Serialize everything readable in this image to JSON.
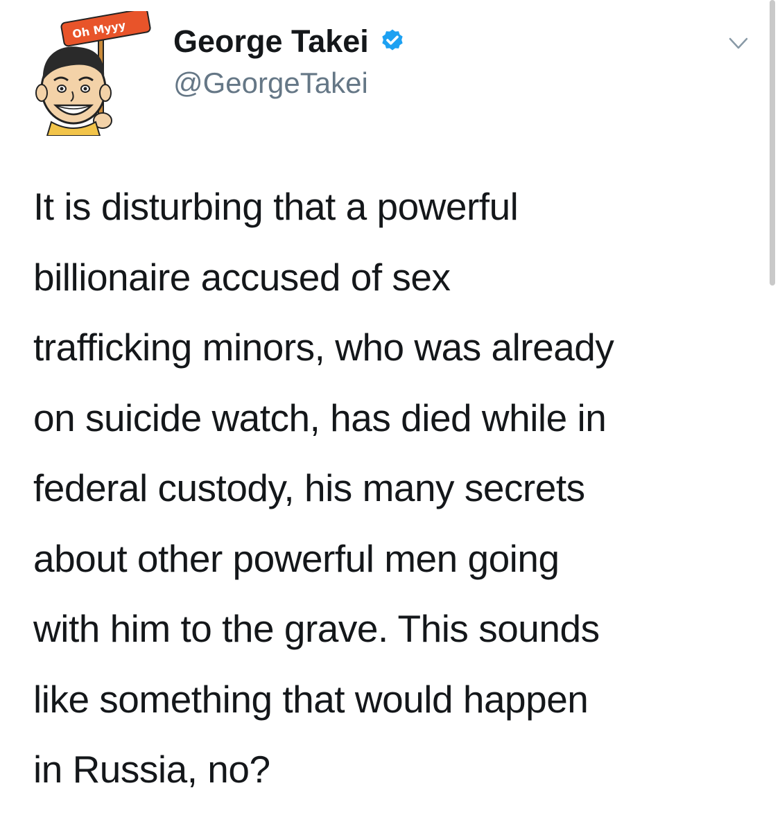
{
  "author": {
    "name": "George Takei",
    "handle": "@GeorgeTakei",
    "verified": true,
    "avatar_sign_text": "Oh Myyy"
  },
  "tweet": {
    "lines": [
      "It is disturbing that a powerful",
      "billionaire accused of sex",
      "trafficking minors, who was already",
      "on suicide watch, has died while in",
      "federal custody, his many secrets",
      "about other powerful men going",
      "with him to the grave. This sounds",
      "like something that would happen",
      "in Russia, no?"
    ]
  },
  "icons": {
    "verified": "verified-badge-icon",
    "menu": "chevron-down-icon"
  },
  "colors": {
    "verified_blue": "#1da1f2",
    "sign_orange": "#e8542a",
    "text_primary": "#14171a",
    "text_secondary": "#657786"
  }
}
